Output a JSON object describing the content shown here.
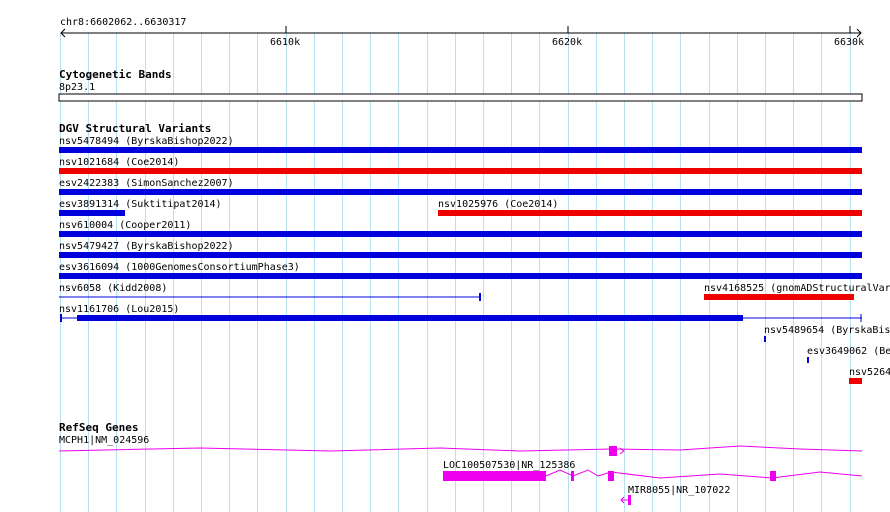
{
  "ruler": {
    "location": "chr8:6602062..6630317",
    "ticks": [
      "6610k",
      "6620k",
      "6630k"
    ]
  },
  "cytoband": {
    "title": "Cytogenetic Bands",
    "band": "8p23.1"
  },
  "dgv": {
    "title": "DGV Structural Variants",
    "features": [
      {
        "label": "nsv5478494 (ByrskaBishop2022)",
        "color": "blue"
      },
      {
        "label": "nsv1021684 (Coe2014)",
        "color": "red"
      },
      {
        "label": "esv2422383 (SimonSanchez2007)",
        "color": "blue"
      },
      {
        "label": "esv3891314 (Suktitipat2014)",
        "color": "blue"
      },
      {
        "label": "nsv1025976 (Coe2014)",
        "color": "red"
      },
      {
        "label": "nsv610004 (Cooper2011)",
        "color": "blue"
      },
      {
        "label": "nsv5479427 (ByrskaBishop2022)",
        "color": "blue"
      },
      {
        "label": "esv3616094 (1000GenomesConsortiumPhase3)",
        "color": "blue"
      },
      {
        "label": "nsv6058 (Kidd2008)",
        "color": "blue"
      },
      {
        "label": "nsv4168525 (gnomADStructuralVar",
        "color": "red"
      },
      {
        "label": "nsv1161706 (Lou2015)",
        "color": "blue"
      },
      {
        "label": "nsv5489654 (ByrskaBis",
        "color": "blue"
      },
      {
        "label": "esv3649062 (Be",
        "color": "blue"
      },
      {
        "label": "nsv5264",
        "color": "red"
      }
    ]
  },
  "refseq": {
    "title": "RefSeq Genes",
    "genes": [
      {
        "label": "MCPH1|NM_024596"
      },
      {
        "label": "LOC100507530|NR_125386"
      },
      {
        "label": "MIR8055|NR_107022"
      }
    ]
  },
  "colors": {
    "blue": "#0000dd",
    "red": "#ee0000",
    "gene": "#ee00ee",
    "grid": "#b8e0f0"
  }
}
